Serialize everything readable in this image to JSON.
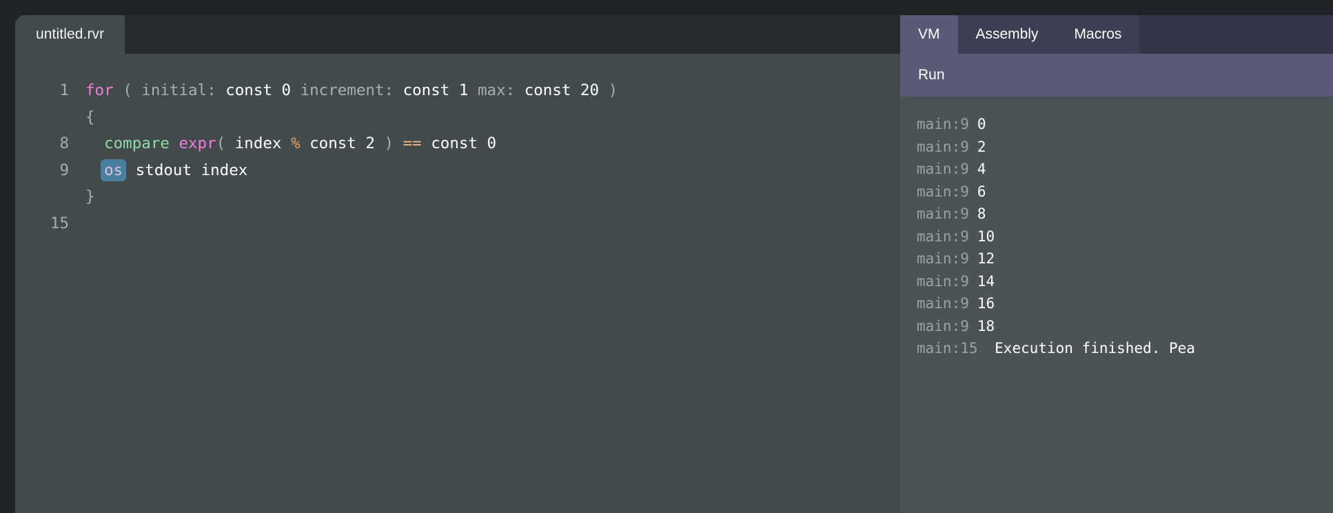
{
  "window": {
    "background_color": "#202325",
    "outer_margin_color": "#1e2022"
  },
  "editor": {
    "background_color": "#434a4c",
    "tabstrip_color": "#282c2e",
    "file_tab": {
      "label": "untitled.rvr",
      "active": true
    },
    "lines": [
      {
        "number": "1",
        "tokens": [
          {
            "text": "for",
            "style": "key"
          },
          {
            "text": " ",
            "style": "plain"
          },
          {
            "text": "(",
            "style": "punc"
          },
          {
            "text": " ",
            "style": "plain"
          },
          {
            "text": "initial:",
            "style": "dim"
          },
          {
            "text": " ",
            "style": "plain"
          },
          {
            "text": "const 0",
            "style": "plain"
          },
          {
            "text": " ",
            "style": "plain"
          },
          {
            "text": "increment:",
            "style": "dim"
          },
          {
            "text": " ",
            "style": "plain"
          },
          {
            "text": "const 1",
            "style": "plain"
          },
          {
            "text": " ",
            "style": "plain"
          },
          {
            "text": "max:",
            "style": "dim"
          },
          {
            "text": " ",
            "style": "plain"
          },
          {
            "text": "const 20",
            "style": "plain"
          },
          {
            "text": " ",
            "style": "plain"
          },
          {
            "text": ")",
            "style": "punc"
          }
        ]
      },
      {
        "number": "",
        "tokens": [
          {
            "text": "{",
            "style": "punc"
          }
        ]
      },
      {
        "number": "8",
        "tokens": [
          {
            "text": "  ",
            "style": "plain"
          },
          {
            "text": "compare",
            "style": "fn"
          },
          {
            "text": " ",
            "style": "plain"
          },
          {
            "text": "expr",
            "style": "key"
          },
          {
            "text": "(",
            "style": "punc"
          },
          {
            "text": " ",
            "style": "plain"
          },
          {
            "text": "index",
            "style": "plain"
          },
          {
            "text": " ",
            "style": "plain"
          },
          {
            "text": "%",
            "style": "op"
          },
          {
            "text": " ",
            "style": "plain"
          },
          {
            "text": "const 2",
            "style": "plain"
          },
          {
            "text": " ",
            "style": "plain"
          },
          {
            "text": ")",
            "style": "punc"
          },
          {
            "text": " ",
            "style": "plain"
          },
          {
            "text": "==",
            "style": "opeq"
          },
          {
            "text": " ",
            "style": "plain"
          },
          {
            "text": "const 0",
            "style": "plain"
          }
        ]
      },
      {
        "number": "9",
        "tokens": [
          {
            "text": "  ",
            "style": "plain"
          },
          {
            "text": "os",
            "style": "sel"
          },
          {
            "text": " ",
            "style": "plain"
          },
          {
            "text": "stdout",
            "style": "plain"
          },
          {
            "text": " ",
            "style": "plain"
          },
          {
            "text": "index",
            "style": "plain"
          }
        ]
      },
      {
        "number": "",
        "tokens": [
          {
            "text": "}",
            "style": "punc"
          }
        ]
      },
      {
        "number": "15",
        "tokens": []
      }
    ]
  },
  "vm_panel": {
    "background_color": "#5a5a77",
    "tab_inactive_color": "#3e3e55",
    "output_background_color": "#4b5356",
    "tabs": [
      {
        "label": "VM",
        "active": true
      },
      {
        "label": "Assembly",
        "active": false
      },
      {
        "label": "Macros",
        "active": false
      }
    ],
    "toolbar": {
      "run_label": "Run"
    },
    "output_lines": [
      {
        "source": "main:9",
        "value": "0"
      },
      {
        "source": "main:9",
        "value": "2"
      },
      {
        "source": "main:9",
        "value": "4"
      },
      {
        "source": "main:9",
        "value": "6"
      },
      {
        "source": "main:9",
        "value": "8"
      },
      {
        "source": "main:9",
        "value": "10"
      },
      {
        "source": "main:9",
        "value": "12"
      },
      {
        "source": "main:9",
        "value": "14"
      },
      {
        "source": "main:9",
        "value": "16"
      },
      {
        "source": "main:9",
        "value": "18"
      },
      {
        "source": "main:15",
        "value": " Execution finished. Pea"
      }
    ]
  }
}
